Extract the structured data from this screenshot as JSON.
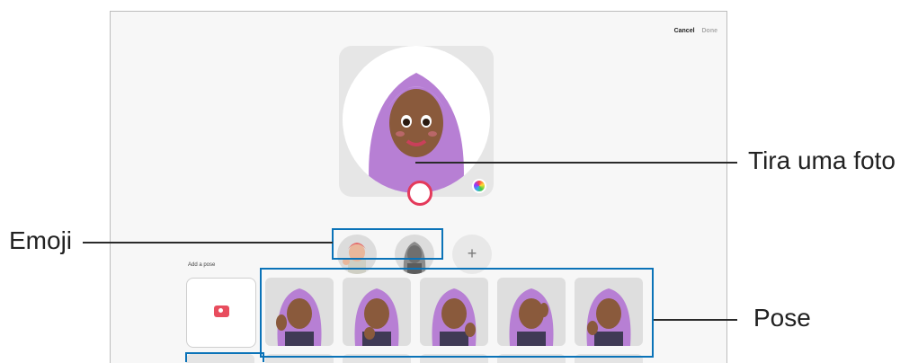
{
  "topbar": {
    "cancel": "Cancel",
    "done": "Done"
  },
  "pose_section": {
    "label": "Add a pose"
  },
  "emoji": {
    "add_symbol": "+"
  },
  "callouts": {
    "shutter": "Tira uma foto",
    "emoji": "Emoji",
    "pose": "Pose"
  },
  "colors": {
    "accent": "#0b73b8",
    "shutter_ring": "#e43a5b",
    "hair": "#b77fd4"
  }
}
